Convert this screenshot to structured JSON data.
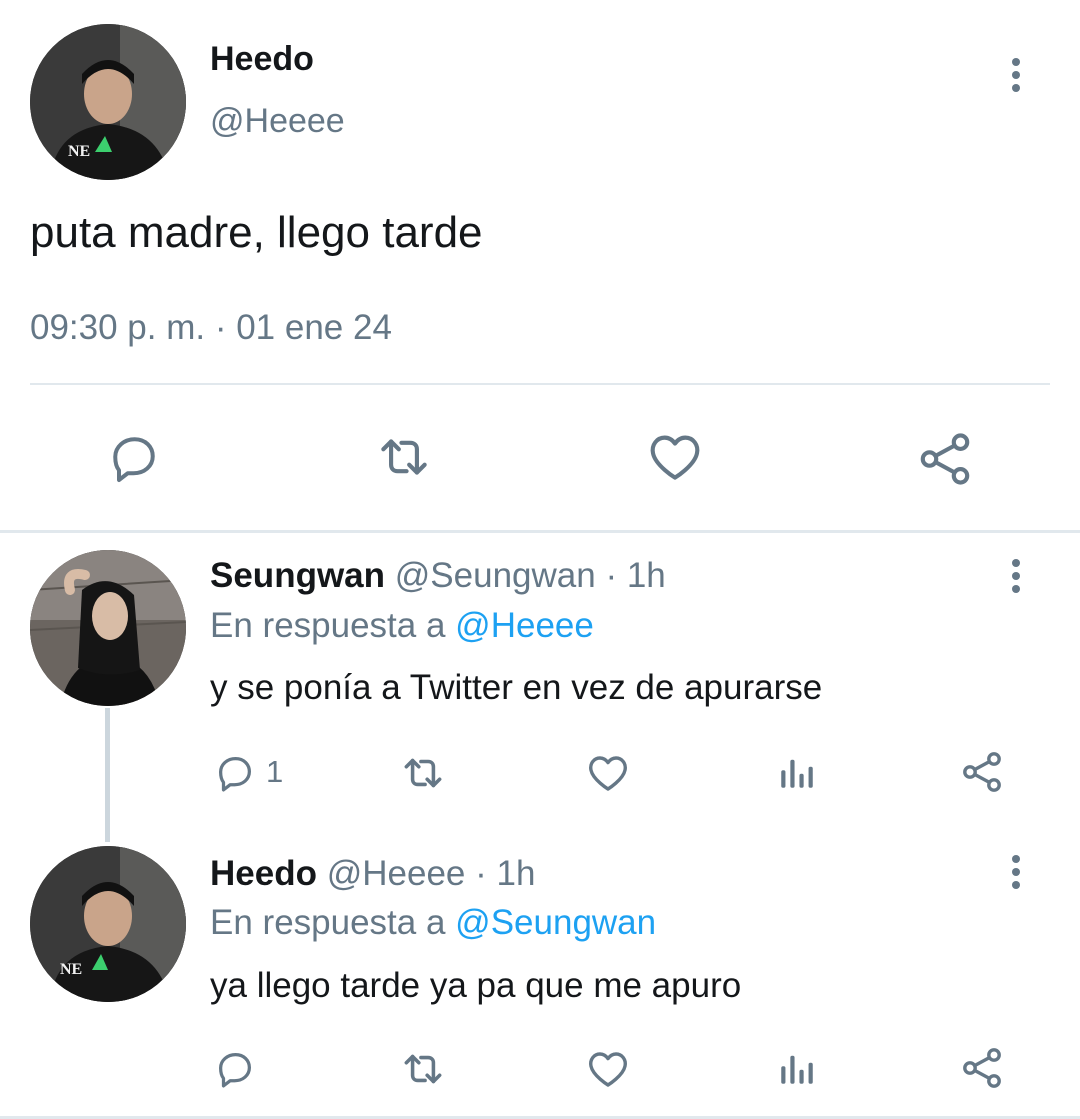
{
  "main_tweet": {
    "display_name": "Heedo",
    "handle": "@Heeee",
    "text": "puta madre, llego tarde",
    "timestamp": "09:30 p. m. · 01 ene 24"
  },
  "replies": [
    {
      "display_name": "Seungwan",
      "handle": "@Seungwan",
      "time": "· 1h",
      "reply_prefix": "En respuesta a",
      "reply_to": "@Heeee",
      "text": "y se ponía a Twitter en vez de apurarse",
      "reply_count": "1"
    },
    {
      "display_name": "Heedo",
      "handle": "@Heeee",
      "time": "· 1h",
      "reply_prefix": "En respuesta a",
      "reply_to": "@Seungwan",
      "text": "ya llego tarde ya pa que me apuro",
      "reply_count": ""
    }
  ],
  "avatar_text": "NE",
  "colors": {
    "text": "#14171a",
    "muted": "#657786",
    "link": "#1da1f2",
    "icon": "#657786",
    "divider": "#e1e8ed"
  }
}
